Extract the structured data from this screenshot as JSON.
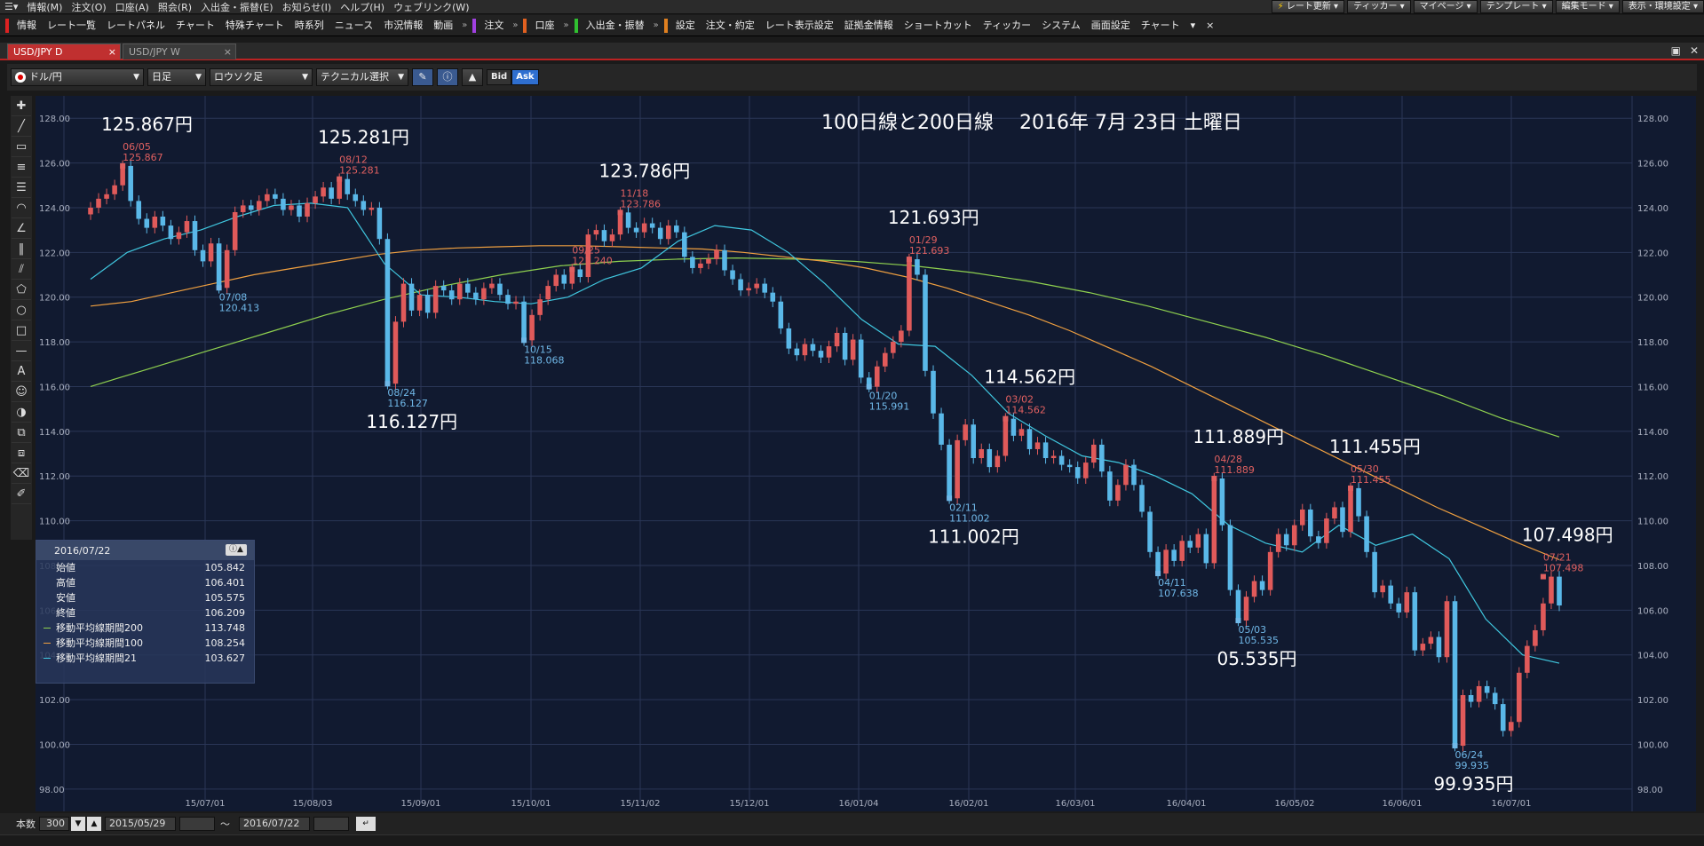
{
  "menubar": {
    "items": [
      "情報(M)",
      "注文(O)",
      "口座(A)",
      "照会(R)",
      "入出金・振替(E)",
      "お知らせ(I)",
      "ヘルプ(H)",
      "ウェブリンク(W)"
    ],
    "right_buttons": [
      "レート更新",
      "ティッカー",
      "マイページ",
      "テンプレート",
      "編集モード",
      "表示・環境設定"
    ]
  },
  "toolbar": {
    "group1_label": "情報",
    "group1_items": [
      "レート一覧",
      "レートパネル",
      "チャート",
      "特殊チャート",
      "時系列",
      "ニュース",
      "市況情報",
      "動画"
    ],
    "order_label": "注文",
    "account_label": "口座",
    "deposit_label": "入出金・振替",
    "settings_label": "設定",
    "settings_items": [
      "注文・約定",
      "レート表示設定",
      "証拠金情報",
      "ショートカット",
      "ティッカー",
      "システム",
      "画面設定",
      "チャート"
    ],
    "close_mark": "×"
  },
  "tabs": [
    {
      "label": "USD/JPY D",
      "active": true
    },
    {
      "label": "USD/JPY W",
      "active": false
    }
  ],
  "chart_toolbar": {
    "pair": "ドル/円",
    "timeframe": "日足",
    "chart_style": "ロウソク足",
    "technical": "テクニカル選択",
    "bid": "Bid",
    "ask": "Ask"
  },
  "info_panel": {
    "date": "2016/07/22",
    "rows": [
      {
        "label": "始値",
        "value": "105.842",
        "color": ""
      },
      {
        "label": "高値",
        "value": "106.401",
        "color": ""
      },
      {
        "label": "安値",
        "value": "105.575",
        "color": ""
      },
      {
        "label": "終値",
        "value": "106.209",
        "color": ""
      },
      {
        "label": "移動平均線期間200",
        "value": "113.748",
        "color": "#8fd14f"
      },
      {
        "label": "移動平均線期間100",
        "value": "108.254",
        "color": "#f0a040"
      },
      {
        "label": "移動平均線期間21",
        "value": "103.627",
        "color": "#40c8e0"
      }
    ]
  },
  "bottom_bar": {
    "count_label": "本数",
    "count_value": "300",
    "from_date": "2015/05/29",
    "tilde": "～",
    "to_date": "2016/07/22"
  },
  "chart_data": {
    "type": "candlestick",
    "title": "100日線と200日線　 2016年 7月 23日 土曜日",
    "ylim": [
      97,
      129
    ],
    "y_ticks": [
      98,
      100,
      102,
      104,
      106,
      108,
      110,
      112,
      114,
      116,
      118,
      120,
      122,
      124,
      126,
      128
    ],
    "x_ticks": [
      "15/07/01",
      "15/08/03",
      "15/09/01",
      "15/10/01",
      "15/11/02",
      "15/12/01",
      "16/01/04",
      "16/02/01",
      "16/03/01",
      "16/04/01",
      "16/05/02",
      "16/06/01",
      "16/07/01"
    ],
    "colors": {
      "up": "#e05a5a",
      "down": "#5ab8e8",
      "ma21": "#40c8e0",
      "ma100": "#f0a040",
      "ma200": "#8fd14f",
      "high_label": "#e06060",
      "low_label": "#70b8e8",
      "background": "#111a30"
    },
    "close_series": [
      124.0,
      124.4,
      124.6,
      125.0,
      125.867,
      124.3,
      123.5,
      123.1,
      123.6,
      123.2,
      122.6,
      122.9,
      123.4,
      122.1,
      121.6,
      122.4,
      120.413,
      122.1,
      123.8,
      124.1,
      123.9,
      124.3,
      124.6,
      124.4,
      123.9,
      124.1,
      123.6,
      124.2,
      124.5,
      124.9,
      124.4,
      125.281,
      124.6,
      124.3,
      123.9,
      124.0,
      122.6,
      116.127,
      118.9,
      120.6,
      119.4,
      120.1,
      119.3,
      120.5,
      120.3,
      119.9,
      120.6,
      120.2,
      119.9,
      120.4,
      120.6,
      120.1,
      119.7,
      119.8,
      118.068,
      119.2,
      119.9,
      120.5,
      121.0,
      120.6,
      121.24,
      120.9,
      122.8,
      123.0,
      122.5,
      122.8,
      123.786,
      123.1,
      122.9,
      123.3,
      123.1,
      122.6,
      123.2,
      122.9,
      121.8,
      121.3,
      121.5,
      121.7,
      122.1,
      121.2,
      120.8,
      120.3,
      120.4,
      120.6,
      120.2,
      119.8,
      118.6,
      117.7,
      117.4,
      117.9,
      117.6,
      117.3,
      117.8,
      118.4,
      117.2,
      118.1,
      116.4,
      115.991,
      116.9,
      117.5,
      118.0,
      118.5,
      121.693,
      121.0,
      116.7,
      114.8,
      113.4,
      111.002,
      113.6,
      114.3,
      112.8,
      113.2,
      112.4,
      112.9,
      114.562,
      113.8,
      114.1,
      113.2,
      113.5,
      112.8,
      112.9,
      112.5,
      112.4,
      111.9,
      112.6,
      113.4,
      112.2,
      110.9,
      111.6,
      112.5,
      111.6,
      110.4,
      108.6,
      107.638,
      108.7,
      108.2,
      109.1,
      108.8,
      109.4,
      108.1,
      111.889,
      109.8,
      106.9,
      105.535,
      106.6,
      107.3,
      106.9,
      108.6,
      109.4,
      108.9,
      109.8,
      110.5,
      109.3,
      109.0,
      110.1,
      110.6,
      109.5,
      111.455,
      110.2,
      108.6,
      106.8,
      107.1,
      106.3,
      105.9,
      106.8,
      104.2,
      104.5,
      104.8,
      103.9,
      106.4,
      99.935,
      102.2,
      101.9,
      102.6,
      102.3,
      101.8,
      100.6,
      101.0,
      103.2,
      104.4,
      105.1,
      106.3,
      107.498,
      106.209
    ],
    "ma100": [
      119.6,
      119.8,
      120.2,
      120.6,
      121.0,
      121.3,
      121.6,
      121.9,
      122.1,
      122.2,
      122.25,
      122.3,
      122.3,
      122.25,
      122.2,
      122.15,
      122.0,
      121.8,
      121.6,
      121.3,
      120.9,
      120.4,
      119.8,
      119.2,
      118.5,
      117.7,
      116.9,
      116.0,
      115.1,
      114.2,
      113.3,
      112.4,
      111.5,
      110.6,
      109.8,
      109.0,
      108.254
    ],
    "ma200": [
      116.0,
      116.8,
      117.6,
      118.4,
      119.2,
      119.9,
      120.5,
      121.0,
      121.4,
      121.6,
      121.7,
      121.75,
      121.7,
      121.6,
      121.4,
      121.1,
      120.7,
      120.2,
      119.6,
      118.9,
      118.2,
      117.4,
      116.5,
      115.6,
      114.6,
      113.748
    ],
    "ma21": [
      120.8,
      122.0,
      122.6,
      123.0,
      123.6,
      124.1,
      124.2,
      124.0,
      121.5,
      120.1,
      120.0,
      119.8,
      119.7,
      120.0,
      120.8,
      121.3,
      122.5,
      123.2,
      123.0,
      122.0,
      120.6,
      119.0,
      117.9,
      117.8,
      116.5,
      114.8,
      113.8,
      112.9,
      112.6,
      112.0,
      111.2,
      109.8,
      109.0,
      108.6,
      109.8,
      108.9,
      109.4,
      108.3,
      105.6,
      104.0,
      103.627
    ],
    "annotations": [
      {
        "big": "125.867円",
        "date": "06/05",
        "price": "125.867",
        "kind": "high",
        "xi": 4
      },
      {
        "big": "125.281円",
        "date": "08/12",
        "price": "125.281",
        "kind": "high",
        "xi": 31
      },
      {
        "big": "116.127円",
        "date": "08/24",
        "price": "116.127",
        "kind": "low",
        "xi": 37
      },
      {
        "big": "",
        "date": "07/08",
        "price": "120.413",
        "kind": "low",
        "xi": 16
      },
      {
        "big": "",
        "date": "09/25",
        "price": "121.240",
        "kind": "high",
        "xi": 60
      },
      {
        "big": "",
        "date": "10/15",
        "price": "118.068",
        "kind": "low",
        "xi": 54
      },
      {
        "big": "123.786円",
        "date": "11/18",
        "price": "123.786",
        "kind": "high",
        "xi": 66
      },
      {
        "big": "121.693円",
        "date": "01/29",
        "price": "121.693",
        "kind": "high",
        "xi": 102
      },
      {
        "big": "",
        "date": "01/20",
        "price": "115.991",
        "kind": "low",
        "xi": 97
      },
      {
        "big": "111.002円",
        "date": "02/11",
        "price": "111.002",
        "kind": "low",
        "xi": 107
      },
      {
        "big": "114.562円",
        "date": "03/02",
        "price": "114.562",
        "kind": "high",
        "xi": 114
      },
      {
        "big": "",
        "date": "04/11",
        "price": "107.638",
        "kind": "low",
        "xi": 133
      },
      {
        "big": "111.889円",
        "date": "04/28",
        "price": "111.889",
        "kind": "high",
        "xi": 140
      },
      {
        "big": "05.535円",
        "date": "05/03",
        "price": "105.535",
        "kind": "low",
        "xi": 143
      },
      {
        "big": "111.455円",
        "date": "05/30",
        "price": "111.455",
        "kind": "high",
        "xi": 157
      },
      {
        "big": "99.935円",
        "date": "06/24",
        "price": "99.935",
        "kind": "low",
        "xi": 170
      },
      {
        "big": "107.498円",
        "date": "07/21",
        "price": "107.498",
        "kind": "high",
        "xi": 181
      }
    ]
  }
}
